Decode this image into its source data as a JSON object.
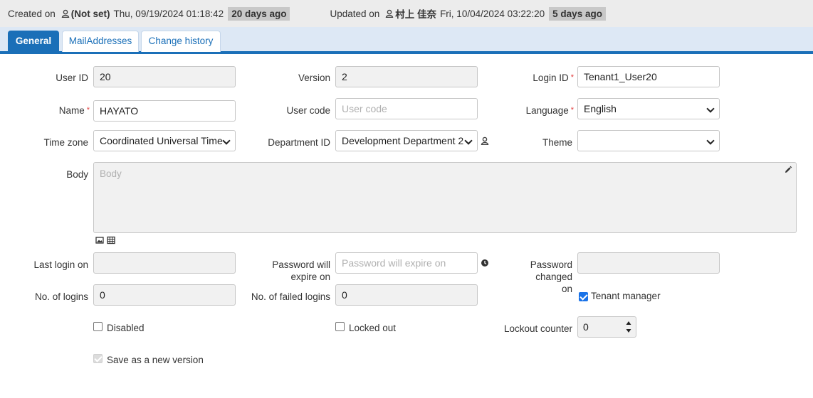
{
  "header": {
    "created_label": "Created on",
    "created_by": "(Not set)",
    "created_at": "Thu, 09/19/2024 01:18:42",
    "created_ago": "20 days ago",
    "updated_label": "Updated on",
    "updated_by": "村上 佳奈",
    "updated_at": "Fri, 10/04/2024 03:22:20",
    "updated_ago": "5 days ago"
  },
  "tabs": [
    {
      "label": "General",
      "active": true
    },
    {
      "label": "MailAddresses",
      "active": false
    },
    {
      "label": "Change history",
      "active": false
    }
  ],
  "form": {
    "user_id": {
      "label": "User ID",
      "value": "20"
    },
    "version": {
      "label": "Version",
      "value": "2"
    },
    "login_id": {
      "label": "Login ID",
      "value": "Tenant1_User20",
      "required": true
    },
    "name": {
      "label": "Name",
      "value": "HAYATO",
      "required": true
    },
    "user_code": {
      "label": "User code",
      "placeholder": "User code"
    },
    "language": {
      "label": "Language",
      "value": "English",
      "required": true
    },
    "time_zone": {
      "label": "Time zone",
      "value": "Coordinated Universal Time"
    },
    "department_id": {
      "label": "Department ID",
      "value": "Development Department 2"
    },
    "theme": {
      "label": "Theme",
      "value": ""
    },
    "body": {
      "label": "Body",
      "placeholder": "Body"
    },
    "last_login_on": {
      "label": "Last login on",
      "value": ""
    },
    "password_expire": {
      "label_line1": "Password will",
      "label_line2": "expire on",
      "placeholder": "Password will expire on"
    },
    "password_changed": {
      "label_line1": "Password changed",
      "label_line2": "on",
      "value": ""
    },
    "no_of_logins": {
      "label": "No. of logins",
      "value": "0"
    },
    "no_of_failed_logins": {
      "label": "No. of failed logins",
      "value": "0"
    },
    "tenant_manager": {
      "label": "Tenant manager",
      "checked": true
    },
    "disabled": {
      "label": "Disabled",
      "checked": false
    },
    "locked_out": {
      "label": "Locked out",
      "checked": false
    },
    "lockout_counter": {
      "label": "Lockout counter",
      "value": "0"
    },
    "save_as_new_version": {
      "label": "Save as a new version",
      "checked": true
    }
  },
  "colors": {
    "accent": "#1a6fb8",
    "required": "#e23b3b",
    "checkbox": "#1a73e8"
  }
}
